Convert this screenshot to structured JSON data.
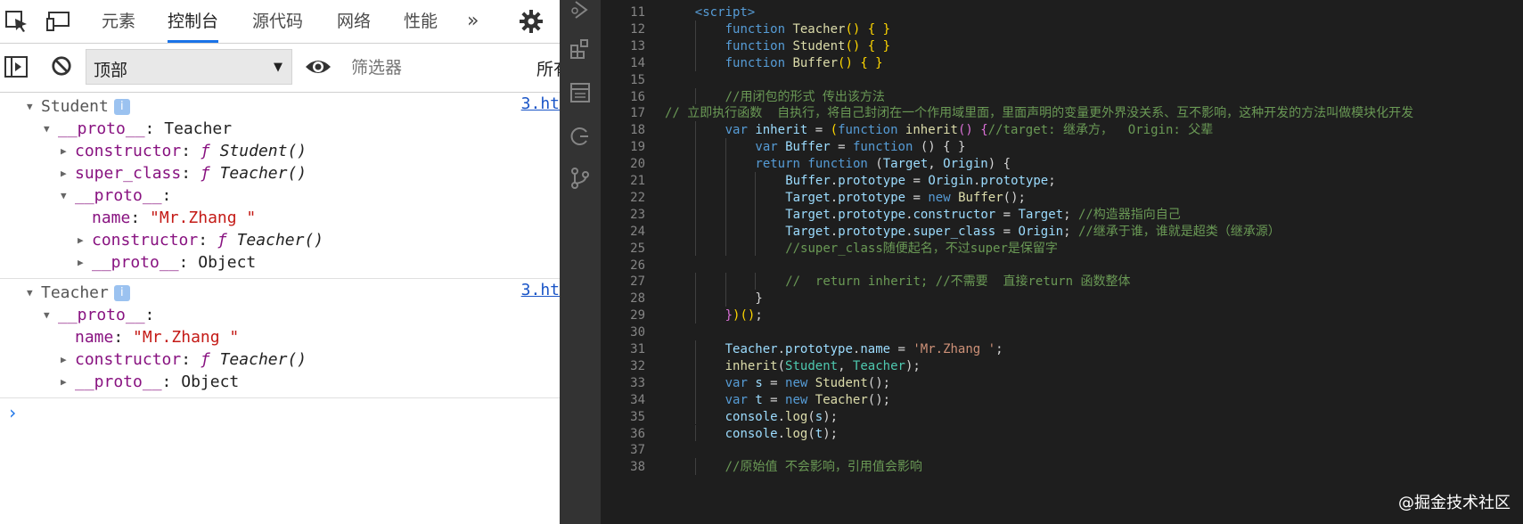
{
  "devtools": {
    "tabs": [
      "元素",
      "控制台",
      "源代码",
      "网络",
      "性能"
    ],
    "active_tab": "控制台",
    "more_label": "»",
    "context_value": "顶部",
    "filter_placeholder": "筛选器",
    "levels_label": "所有"
  },
  "console": {
    "groups": [
      {
        "title": "Student",
        "source": "3.ht",
        "lines": [
          {
            "indent": 1,
            "expanded": true,
            "parts": [
              [
                "key",
                "__proto__"
              ],
              [
                "pun",
                ": "
              ],
              [
                "plain",
                "Teacher"
              ]
            ]
          },
          {
            "indent": 2,
            "expanded": false,
            "parts": [
              [
                "key",
                "constructor"
              ],
              [
                "pun",
                ": "
              ],
              [
                "fn",
                "ƒ "
              ],
              [
                "fname",
                "Student()"
              ]
            ]
          },
          {
            "indent": 2,
            "expanded": false,
            "parts": [
              [
                "key",
                "super_class"
              ],
              [
                "pun",
                ": "
              ],
              [
                "fn",
                "ƒ "
              ],
              [
                "fname",
                "Teacher()"
              ]
            ]
          },
          {
            "indent": 2,
            "expanded": true,
            "parts": [
              [
                "key",
                "__proto__"
              ],
              [
                "pun",
                ":"
              ]
            ]
          },
          {
            "indent": 3,
            "expanded": null,
            "parts": [
              [
                "key",
                "name"
              ],
              [
                "pun",
                ": "
              ],
              [
                "str",
                "\"Mr.Zhang \""
              ]
            ]
          },
          {
            "indent": 3,
            "expanded": false,
            "parts": [
              [
                "key",
                "constructor"
              ],
              [
                "pun",
                ": "
              ],
              [
                "fn",
                "ƒ "
              ],
              [
                "fname",
                "Teacher()"
              ]
            ]
          },
          {
            "indent": 3,
            "expanded": false,
            "parts": [
              [
                "key",
                "__proto__"
              ],
              [
                "pun",
                ": "
              ],
              [
                "plain",
                "Object"
              ]
            ]
          }
        ]
      },
      {
        "title": "Teacher",
        "source": "3.ht",
        "lines": [
          {
            "indent": 1,
            "expanded": true,
            "parts": [
              [
                "key",
                "__proto__"
              ],
              [
                "pun",
                ":"
              ]
            ]
          },
          {
            "indent": 2,
            "expanded": null,
            "parts": [
              [
                "key",
                "name"
              ],
              [
                "pun",
                ": "
              ],
              [
                "str",
                "\"Mr.Zhang \""
              ]
            ]
          },
          {
            "indent": 2,
            "expanded": false,
            "parts": [
              [
                "key",
                "constructor"
              ],
              [
                "pun",
                ": "
              ],
              [
                "fn",
                "ƒ "
              ],
              [
                "fname",
                "Teacher()"
              ]
            ]
          },
          {
            "indent": 2,
            "expanded": false,
            "parts": [
              [
                "key",
                "__proto__"
              ],
              [
                "pun",
                ": "
              ],
              [
                "plain",
                "Object"
              ]
            ]
          }
        ]
      }
    ],
    "prompt": "›"
  },
  "editor": {
    "lines": [
      {
        "n": 11,
        "indent": 1,
        "tokens": [
          [
            "tag",
            "<script>"
          ]
        ]
      },
      {
        "n": 12,
        "indent": 2,
        "tokens": [
          [
            "kw",
            "function "
          ],
          [
            "fn",
            "Teacher"
          ],
          [
            "br1",
            "() { }"
          ]
        ]
      },
      {
        "n": 13,
        "indent": 2,
        "tokens": [
          [
            "kw",
            "function "
          ],
          [
            "fn",
            "Student"
          ],
          [
            "br1",
            "() { }"
          ]
        ]
      },
      {
        "n": 14,
        "indent": 2,
        "tokens": [
          [
            "kw",
            "function "
          ],
          [
            "fn",
            "Buffer"
          ],
          [
            "br1",
            "() { }"
          ]
        ]
      },
      {
        "n": 15,
        "indent": 0,
        "tokens": []
      },
      {
        "n": 16,
        "indent": 2,
        "tokens": [
          [
            "com",
            "//用闭包的形式 传出该方法"
          ]
        ]
      },
      {
        "n": 17,
        "indent": 0,
        "tokens": [
          [
            "com",
            "// 立即执行函数  自执行，将自己封闭在一个作用域里面，里面声明的变量更外界没关系、互不影响，这种开发的方法叫做模块化开发"
          ]
        ]
      },
      {
        "n": 18,
        "indent": 2,
        "tokens": [
          [
            "kw",
            "var "
          ],
          [
            "var",
            "inherit"
          ],
          [
            "pun",
            " = "
          ],
          [
            "br1",
            "("
          ],
          [
            "kw",
            "function "
          ],
          [
            "fn",
            "inherit"
          ],
          [
            "br2",
            "() {"
          ],
          [
            "com",
            "//target: 继承方，  Origin: 父辈"
          ]
        ]
      },
      {
        "n": 19,
        "indent": 3,
        "tokens": [
          [
            "kw",
            "var "
          ],
          [
            "var",
            "Buffer"
          ],
          [
            "pun",
            " = "
          ],
          [
            "kw",
            "function "
          ],
          [
            "pun",
            "() { }"
          ]
        ]
      },
      {
        "n": 20,
        "indent": 3,
        "tokens": [
          [
            "kw",
            "return "
          ],
          [
            "kw",
            "function "
          ],
          [
            "pun",
            "("
          ],
          [
            "var",
            "Target"
          ],
          [
            "pun",
            ", "
          ],
          [
            "var",
            "Origin"
          ],
          [
            "pun",
            ") {"
          ]
        ]
      },
      {
        "n": 21,
        "indent": 4,
        "tokens": [
          [
            "var",
            "Buffer"
          ],
          [
            "pun",
            "."
          ],
          [
            "var",
            "prototype"
          ],
          [
            "pun",
            " = "
          ],
          [
            "var",
            "Origin"
          ],
          [
            "pun",
            "."
          ],
          [
            "var",
            "prototype"
          ],
          [
            "pun",
            ";"
          ]
        ]
      },
      {
        "n": 22,
        "indent": 4,
        "tokens": [
          [
            "var",
            "Target"
          ],
          [
            "pun",
            "."
          ],
          [
            "var",
            "prototype"
          ],
          [
            "pun",
            " = "
          ],
          [
            "kw",
            "new "
          ],
          [
            "fn",
            "Buffer"
          ],
          [
            "pun",
            "();"
          ]
        ]
      },
      {
        "n": 23,
        "indent": 4,
        "tokens": [
          [
            "var",
            "Target"
          ],
          [
            "pun",
            "."
          ],
          [
            "var",
            "prototype"
          ],
          [
            "pun",
            "."
          ],
          [
            "var",
            "constructor"
          ],
          [
            "pun",
            " = "
          ],
          [
            "var",
            "Target"
          ],
          [
            "pun",
            "; "
          ],
          [
            "com",
            "//构造器指向自己"
          ]
        ]
      },
      {
        "n": 24,
        "indent": 4,
        "tokens": [
          [
            "var",
            "Target"
          ],
          [
            "pun",
            "."
          ],
          [
            "var",
            "prototype"
          ],
          [
            "pun",
            "."
          ],
          [
            "var",
            "super_class"
          ],
          [
            "pun",
            " = "
          ],
          [
            "var",
            "Origin"
          ],
          [
            "pun",
            "; "
          ],
          [
            "com",
            "//继承于谁，谁就是超类（继承源）"
          ]
        ]
      },
      {
        "n": 25,
        "indent": 4,
        "tokens": [
          [
            "com",
            "//super_class随便起名，不过super是保留字"
          ]
        ]
      },
      {
        "n": 26,
        "indent": 0,
        "tokens": []
      },
      {
        "n": 27,
        "indent": 4,
        "tokens": [
          [
            "com",
            "//  return inherit; //不需要  直接return 函数整体"
          ]
        ]
      },
      {
        "n": 28,
        "indent": 3,
        "tokens": [
          [
            "pun",
            "}"
          ]
        ]
      },
      {
        "n": 29,
        "indent": 2,
        "tokens": [
          [
            "br2",
            "}"
          ],
          [
            "br1",
            ")()"
          ],
          [
            "pun",
            ";"
          ]
        ]
      },
      {
        "n": 30,
        "indent": 0,
        "tokens": []
      },
      {
        "n": 31,
        "indent": 2,
        "tokens": [
          [
            "var",
            "Teacher"
          ],
          [
            "pun",
            "."
          ],
          [
            "var",
            "prototype"
          ],
          [
            "pun",
            "."
          ],
          [
            "var",
            "name"
          ],
          [
            "pun",
            " = "
          ],
          [
            "str",
            "'Mr.Zhang '"
          ],
          [
            "pun",
            ";"
          ]
        ]
      },
      {
        "n": 32,
        "indent": 2,
        "tokens": [
          [
            "fn",
            "inherit"
          ],
          [
            "pun",
            "("
          ],
          [
            "cls",
            "Student"
          ],
          [
            "pun",
            ", "
          ],
          [
            "cls",
            "Teacher"
          ],
          [
            "pun",
            ");"
          ]
        ]
      },
      {
        "n": 33,
        "indent": 2,
        "tokens": [
          [
            "kw",
            "var "
          ],
          [
            "var",
            "s"
          ],
          [
            "pun",
            " = "
          ],
          [
            "kw",
            "new "
          ],
          [
            "fn",
            "Student"
          ],
          [
            "pun",
            "();"
          ]
        ]
      },
      {
        "n": 34,
        "indent": 2,
        "tokens": [
          [
            "kw",
            "var "
          ],
          [
            "var",
            "t"
          ],
          [
            "pun",
            " = "
          ],
          [
            "kw",
            "new "
          ],
          [
            "fn",
            "Teacher"
          ],
          [
            "pun",
            "();"
          ]
        ]
      },
      {
        "n": 35,
        "indent": 2,
        "tokens": [
          [
            "var",
            "console"
          ],
          [
            "pun",
            "."
          ],
          [
            "fn",
            "log"
          ],
          [
            "pun",
            "("
          ],
          [
            "var",
            "s"
          ],
          [
            "pun",
            ");"
          ]
        ]
      },
      {
        "n": 36,
        "indent": 2,
        "tokens": [
          [
            "var",
            "console"
          ],
          [
            "pun",
            "."
          ],
          [
            "fn",
            "log"
          ],
          [
            "pun",
            "("
          ],
          [
            "var",
            "t"
          ],
          [
            "pun",
            ");"
          ]
        ]
      },
      {
        "n": 37,
        "indent": 0,
        "tokens": []
      },
      {
        "n": 38,
        "indent": 2,
        "tokens": [
          [
            "com",
            "//原始值 不会影响，引用值会影响"
          ]
        ]
      }
    ]
  },
  "watermark": "@掘金技术社区",
  "icons": {
    "inspect": "inspect-element-icon",
    "device": "device-toolbar-icon",
    "settings": "gear-icon",
    "sidebar": "console-sidebar-icon",
    "clear": "clear-console-icon",
    "eye": "live-expression-eye-icon",
    "explorer": "explorer-icon",
    "search": "search-icon",
    "scm": "source-control-icon",
    "debug": "run-debug-icon",
    "extensions": "extensions-icon"
  },
  "colors": {
    "accent": "#1a73e8",
    "editor_bg": "#1e1e1e",
    "activity_bar": "#333333"
  }
}
